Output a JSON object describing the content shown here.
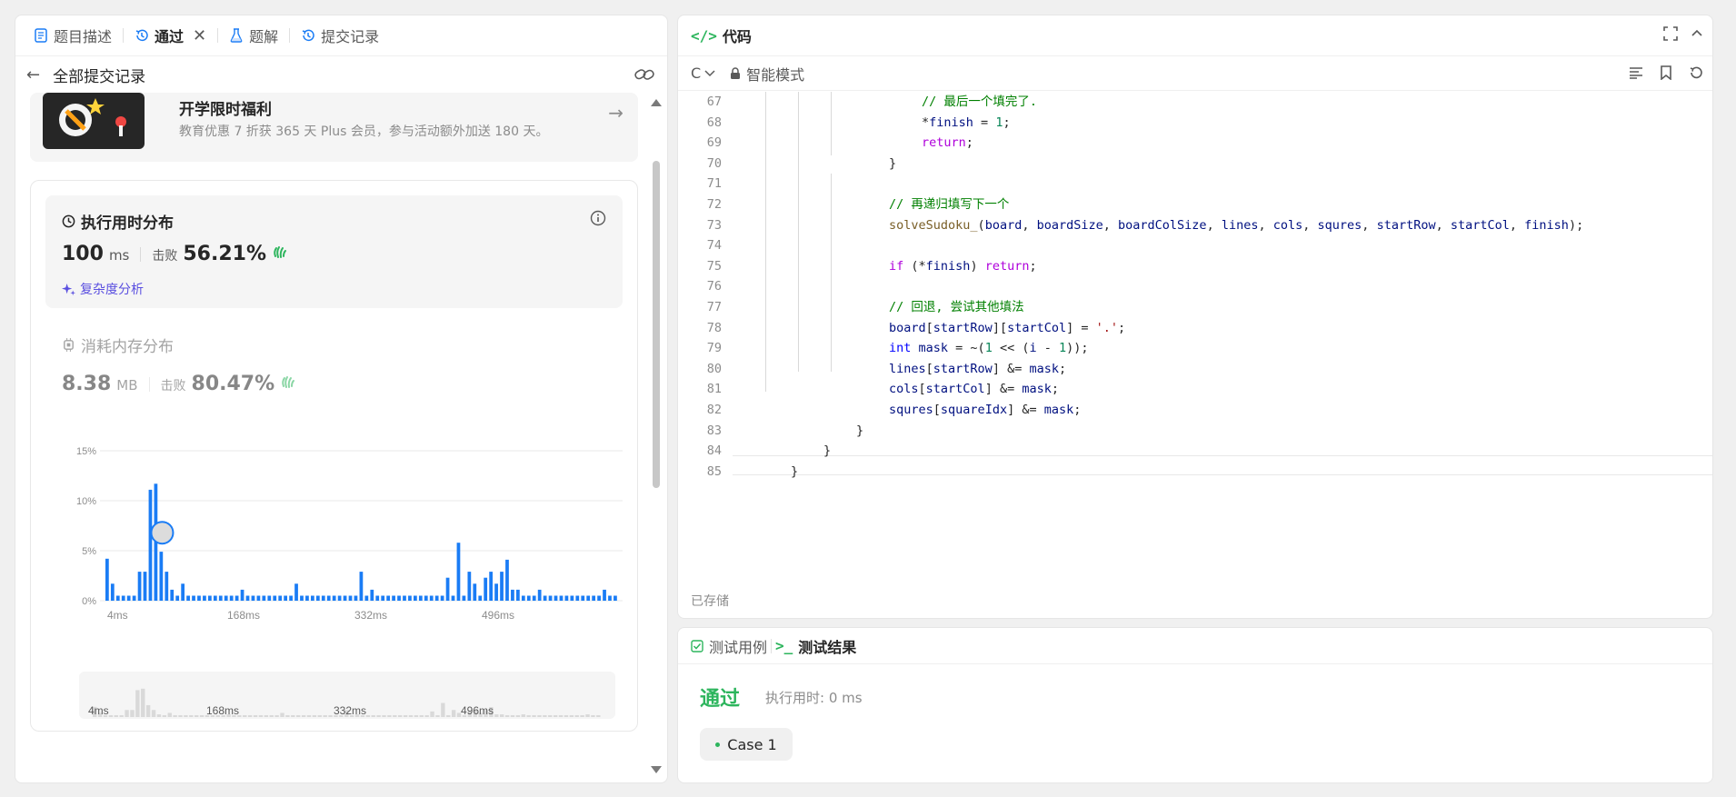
{
  "left_tabs": [
    {
      "label": "题目描述",
      "icon": "document-icon"
    },
    {
      "label": "通过",
      "icon": "history-icon"
    },
    {
      "label": "题解",
      "icon": "flask-icon"
    },
    {
      "label": "提交记录",
      "icon": "history-icon"
    }
  ],
  "subbar": {
    "back_title": "全部提交记录"
  },
  "banner": {
    "title": "开学限时福利",
    "desc": "教育优惠 7 折获 365 天 Plus 会员，参与活动额外加送 180 天。"
  },
  "runtime": {
    "title": "执行用时分布",
    "value": "100",
    "unit": "ms",
    "beat_label": "击败",
    "beat_pct": "56.21%",
    "complexity_label": "复杂度分析"
  },
  "memory": {
    "title": "消耗内存分布",
    "value": "8.38",
    "unit": "MB",
    "beat_label": "击败",
    "beat_pct": "80.47%"
  },
  "chart_data": {
    "type": "bar",
    "ylim": [
      0,
      15
    ],
    "y_ticks": [
      "15%",
      "10%",
      "5%",
      "0%"
    ],
    "x_ticks": [
      "4ms",
      "168ms",
      "332ms",
      "496ms"
    ],
    "values": [
      4.2,
      1.7,
      0.5,
      0.5,
      0.5,
      0.5,
      2.9,
      2.9,
      11.1,
      11.7,
      4.9,
      2.9,
      1.1,
      0.5,
      1.7,
      0.5,
      0.5,
      0.5,
      0.5,
      0.5,
      0.5,
      0.5,
      0.5,
      0.5,
      0.5,
      1.1,
      0.5,
      0.5,
      0.5,
      0.5,
      0.5,
      0.5,
      0.5,
      0.5,
      0.5,
      1.7,
      0.5,
      0.5,
      0.5,
      0.5,
      0.5,
      0.5,
      0.5,
      0.5,
      0.5,
      0.5,
      0.5,
      2.9,
      0.5,
      1.1,
      0.5,
      0.5,
      0.5,
      0.5,
      0.5,
      0.5,
      0.5,
      0.5,
      0.5,
      0.5,
      0.5,
      0.5,
      0.5,
      2.3,
      0.5,
      5.8,
      0.5,
      2.9,
      1.7,
      0.5,
      2.3,
      2.9,
      1.7,
      2.9,
      4.1,
      1.1,
      1.1,
      0.5,
      0.5,
      0.5,
      1.1,
      0.5,
      0.5,
      0.5,
      0.5,
      0.5,
      0.5,
      0.5,
      0.5,
      0.5,
      0.5,
      0.5,
      1.1,
      0.5,
      0.5
    ],
    "highlight_index": 10,
    "bar_color": "#1a7cf5"
  },
  "code_footer": {
    "label": "代码",
    "lang": "C"
  },
  "editor": {
    "title": "代码",
    "lang": "C",
    "mode": "智能模式",
    "saved": "已存储",
    "lines": [
      {
        "n": "67",
        "indent": 2,
        "html": "<span class='c-comment'>// 最后一个填完了.</span>"
      },
      {
        "n": "68",
        "indent": 2,
        "html": "*<span class='c-var'>finish</span> = <span class='c-num'>1</span>;"
      },
      {
        "n": "69",
        "indent": 2,
        "html": "<span class='c-kw'>return</span>;"
      },
      {
        "n": "70",
        "indent": 1,
        "html": "}"
      },
      {
        "n": "71",
        "indent": 1,
        "html": ""
      },
      {
        "n": "72",
        "indent": 1,
        "html": "<span class='c-comment'>// 再递归填写下一个</span>"
      },
      {
        "n": "73",
        "indent": 1,
        "html": "<span class='c-fn'>solveSudoku_</span>(<span class='c-var'>board</span>, <span class='c-var'>boardSize</span>, <span class='c-var'>boardColSize</span>, <span class='c-var'>lines</span>, <span class='c-var'>cols</span>, <span class='c-var'>squres</span>, <span class='c-var'>startRow</span>, <span class='c-var'>startCol</span>, <span class='c-var'>finish</span>);"
      },
      {
        "n": "74",
        "indent": 1,
        "html": ""
      },
      {
        "n": "75",
        "indent": 1,
        "html": "<span class='c-kw'>if</span> (*<span class='c-var'>finish</span>) <span class='c-kw'>return</span>;"
      },
      {
        "n": "76",
        "indent": 1,
        "html": ""
      },
      {
        "n": "77",
        "indent": 1,
        "html": "<span class='c-comment'>// 回退, 尝试其他填法</span>"
      },
      {
        "n": "78",
        "indent": 1,
        "html": "<span class='c-var'>board</span>[<span class='c-var'>startRow</span>][<span class='c-var'>startCol</span>] = <span class='c-str'>'.'</span>;"
      },
      {
        "n": "79",
        "indent": 1,
        "html": "<span class='c-type'>int</span> <span class='c-var'>mask</span> = ~(<span class='c-num'>1</span> &lt;&lt; (<span class='c-var'>i</span> - <span class='c-num'>1</span>));"
      },
      {
        "n": "80",
        "indent": 1,
        "html": "<span class='c-var'>lines</span>[<span class='c-var'>startRow</span>] &amp;= <span class='c-var'>mask</span>;"
      },
      {
        "n": "81",
        "indent": 1,
        "html": "<span class='c-var'>cols</span>[<span class='c-var'>startCol</span>] &amp;= <span class='c-var'>mask</span>;"
      },
      {
        "n": "82",
        "indent": 1,
        "html": "<span class='c-var'>squres</span>[<span class='c-var'>squareIdx</span>] &amp;= <span class='c-var'>mask</span>;"
      },
      {
        "n": "83",
        "indent": 0,
        "html": "}"
      },
      {
        "n": "84",
        "indent": -1,
        "html": "}"
      },
      {
        "n": "85",
        "indent": -2,
        "html": "}"
      }
    ]
  },
  "bottom": {
    "tabs": [
      {
        "label": "测试用例",
        "icon": "checkbox-icon"
      },
      {
        "label": "测试结果",
        "icon": "terminal-icon"
      }
    ],
    "status": "通过",
    "exec_time": "执行用时: 0 ms",
    "case_label": "Case 1"
  }
}
